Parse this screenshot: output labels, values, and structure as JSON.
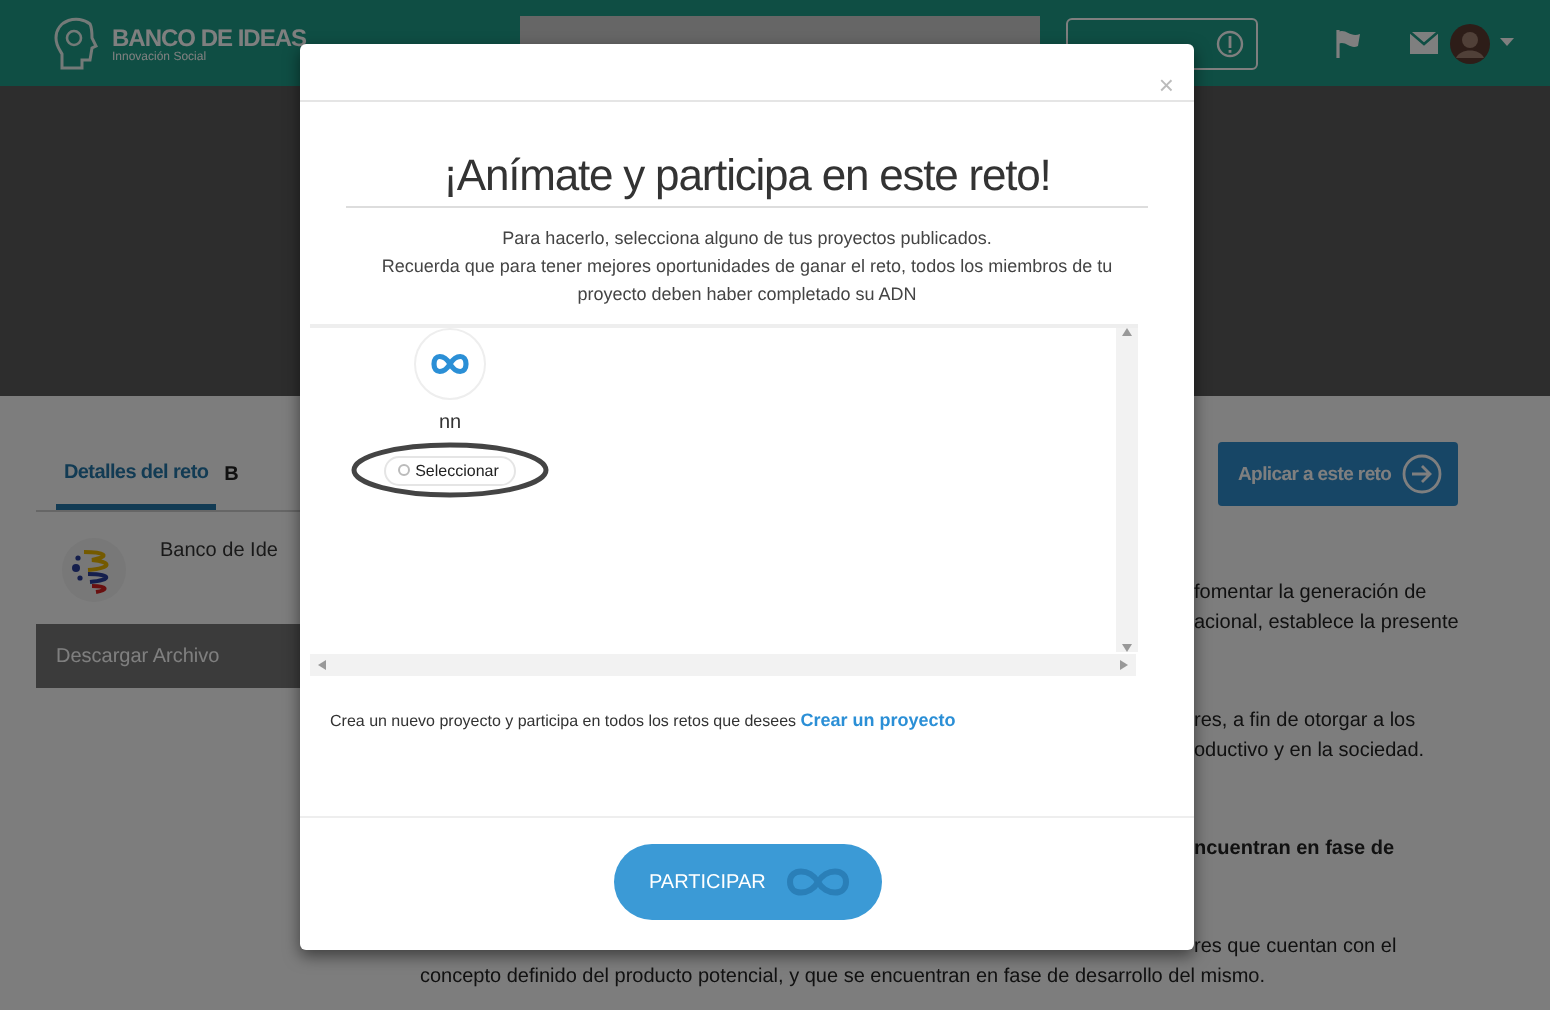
{
  "header": {
    "brand": "BANCO DE IDEAS",
    "tagline": "Innovación Social"
  },
  "tabs": [
    {
      "label": "Detalles del reto",
      "selected": true
    },
    {
      "label": "B",
      "selected": false
    }
  ],
  "apply_button": "Aplicar a este reto",
  "organization": "Banco de Ide",
  "download_button": "Descargar Archivo",
  "side_paragraphs": [
    {
      "lines": [
        "fomentar la generación de",
        "acional, establece la presente"
      ],
      "bold": false
    },
    {
      "lines": [
        "res, a fin de otorgar a los",
        "oductivo y en la sociedad."
      ],
      "bold": false
    },
    {
      "lines": [
        "ncuentran en fase de"
      ],
      "bold": true
    },
    {
      "lines": [
        "res que cuentan con el"
      ],
      "bold": false
    }
  ],
  "bottom_line": "concepto definido del producto potencial, y que se encuentran en fase de desarrollo del mismo.",
  "modal": {
    "close": "×",
    "title": "¡Anímate y participa en este reto!",
    "intro": [
      "Para hacerlo, selecciona alguno de tus proyectos publicados.",
      "Recuerda que para tener mejores oportunidades de ganar el reto, todos los miembros de tu proyecto deben haber completado su ADN"
    ],
    "projects": [
      {
        "name": "nn",
        "select_label": "Seleccionar",
        "selected": false
      }
    ],
    "create_text": "Crea un nuevo proyecto y participa en todos los retos que desees",
    "create_link": "Crear un proyecto",
    "submit_button": "PARTICIPAR"
  }
}
